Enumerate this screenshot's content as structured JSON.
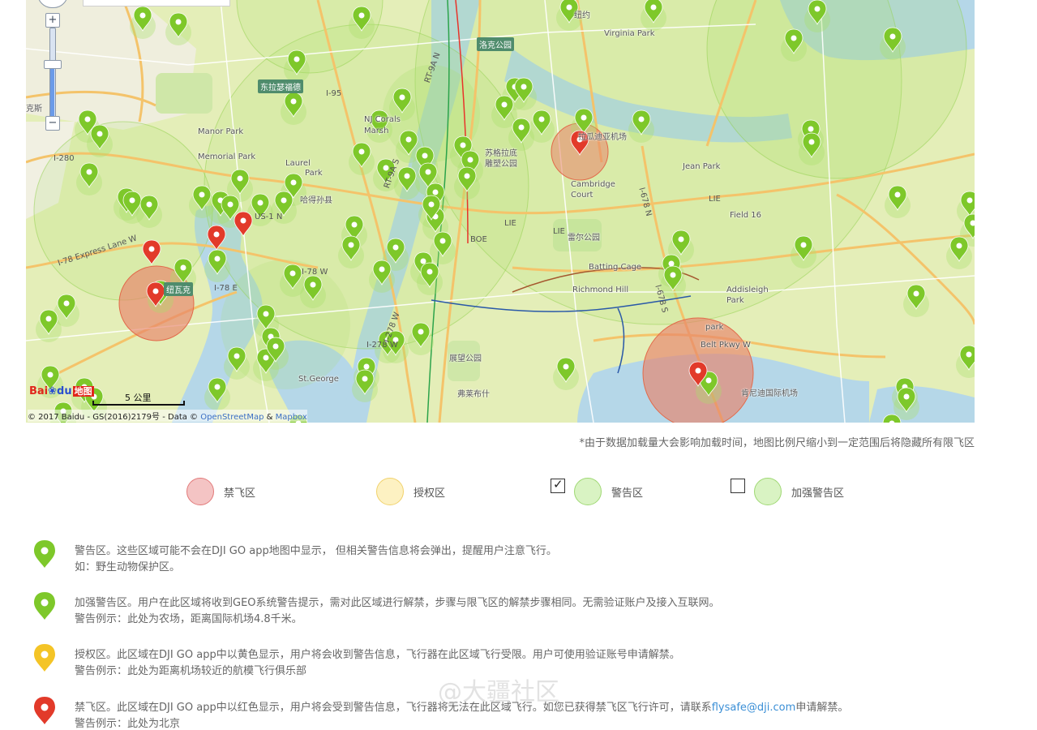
{
  "map": {
    "places": [
      {
        "text": "纽约"
      },
      {
        "text": "洛克公园"
      },
      {
        "text": "Virginia Park"
      },
      {
        "text": "东拉瑟福德"
      },
      {
        "text": "NJ Corals"
      },
      {
        "text": "Marsh"
      },
      {
        "text": "Manor Park"
      },
      {
        "text": "Memorial Park"
      },
      {
        "text": "Laurel"
      },
      {
        "text": "Park"
      },
      {
        "text": "哈得孙县"
      },
      {
        "text": "苏格拉底"
      },
      {
        "text": "雕塑公园"
      },
      {
        "text": "拉瓜迪亚机场"
      },
      {
        "text": "Jean Park"
      },
      {
        "text": "Cambridge"
      },
      {
        "text": "Court"
      },
      {
        "text": "Field 16"
      },
      {
        "text": "雷尔公园"
      },
      {
        "text": "Batting Cage"
      },
      {
        "text": "Richmond Hill"
      },
      {
        "text": "Addisleigh"
      },
      {
        "text": "Park"
      },
      {
        "text": "纽瓦克"
      },
      {
        "text": "St.George"
      },
      {
        "text": "展望公园"
      },
      {
        "text": "弗莱布什"
      },
      {
        "text": "肯尼迪国际机场"
      },
      {
        "text": "park"
      },
      {
        "text": "克斯"
      },
      {
        "text": "Belt Pkwy W"
      },
      {
        "text": "I-78 Express Lane W"
      },
      {
        "text": "I-78 E"
      },
      {
        "text": "I-280"
      },
      {
        "text": "I-95"
      },
      {
        "text": "RT-9A N"
      },
      {
        "text": "RT-9A S"
      },
      {
        "text": "I-278 W"
      },
      {
        "text": "I-678 N"
      },
      {
        "text": "I-678 S"
      },
      {
        "text": "LIE"
      },
      {
        "text": "BOE"
      },
      {
        "text": "US-1 N"
      },
      {
        "text": "I-78 W"
      },
      {
        "text": "I-278 W"
      },
      {
        "text": "LIE"
      },
      {
        "text": "LIE"
      }
    ],
    "zoom_in": "+",
    "zoom_out": "−",
    "scale_label": "5 公里",
    "brand_a": "Bai",
    "brand_b": "du",
    "brand_c": "地图",
    "copyright_prefix": "© 2017 Baidu - GS(2016)2179号 - Data © ",
    "osm_link": "OpenStreetMap",
    "amp": " & ",
    "mapbox_link": "Mapbox",
    "colors": {
      "warning_fill": "#a8e06a",
      "nofly_fill": "#e8836a",
      "nofly_pin": "#e23a2a",
      "warning_pin": "#7ec82a",
      "auth_pin": "#f4c426"
    }
  },
  "note": "*由于数据加载量大会影响加载时间，地图比例尺缩小到一定范围后将隐藏所有限飞区",
  "legend": [
    {
      "label": "禁飞区",
      "fill": "#f4c4c4",
      "stroke": "#e27a7a",
      "checkbox": null
    },
    {
      "label": "授权区",
      "fill": "#fdf1c2",
      "stroke": "#f1d26c",
      "checkbox": null
    },
    {
      "label": "警告区",
      "fill": "#d9f3c3",
      "stroke": "#9fd874",
      "checkbox": true
    },
    {
      "label": "加强警告区",
      "fill": "#d9f3c3",
      "stroke": "#9fd874",
      "checkbox": false
    }
  ],
  "descriptions": [
    {
      "color": "#7ec82a",
      "line1": "警告区。这些区域可能不会在DJI GO app地图中显示， 但相关警告信息将会弹出，提醒用户注意飞行。",
      "line2": "如：野生动物保护区。"
    },
    {
      "color": "#7ec82a",
      "line1": "加强警告区。用户在此区域将收到GEO系统警告提示，需对此区域进行解禁，步骤与限飞区的解禁步骤相同。无需验证账户及接入互联网。",
      "line2": "警告例示：此处为农场，距离国际机场4.8千米。"
    },
    {
      "color": "#f4c426",
      "line1": "授权区。此区域在DJI GO app中以黄色显示，用户将会收到警告信息，飞行器在此区域飞行受限。用户可使用验证账号申请解禁。",
      "line2": "警告例示：此处为距离机场较近的航模飞行俱乐部"
    },
    {
      "color": "#e23a2a",
      "line1a": "禁飞区。此区域在DJI GO app中以红色显示，用户将会受到警告信息，飞行器将无法在此区域飞行。如您已获得禁飞区飞行许可，请联系",
      "email": "flysafe@dji.com",
      "line1b": "申请解禁。",
      "line2": "警告例示：此处为北京"
    }
  ],
  "watermark": "@大疆社区"
}
